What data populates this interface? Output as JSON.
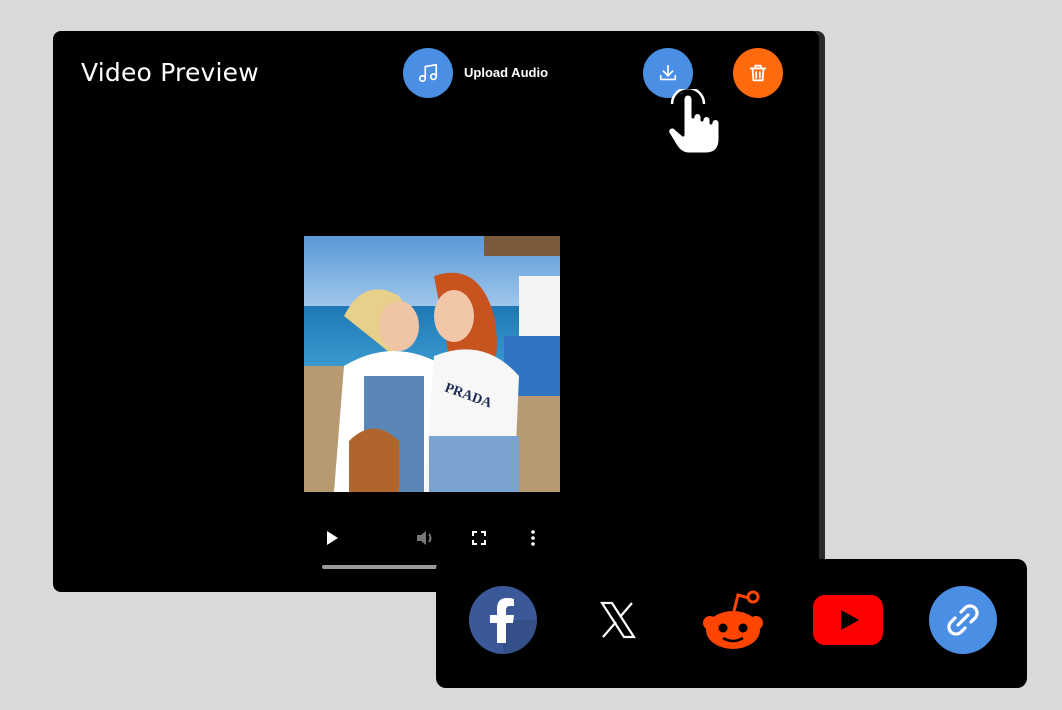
{
  "preview": {
    "title": "Video Preview",
    "upload_label": "Upload Audio"
  },
  "buttons": {
    "upload_icon": "music-note-icon",
    "download_icon": "download-icon",
    "delete_icon": "trash-icon"
  },
  "video_controls": [
    "play-icon",
    "volume-icon",
    "fullscreen-icon",
    "more-options-icon"
  ],
  "playback": {
    "progress": 1.0
  },
  "share": {
    "items": [
      "facebook",
      "x",
      "reddit",
      "youtube",
      "copy-link"
    ]
  },
  "colors": {
    "accent_blue": "#4a8fe3",
    "delete_orange": "#ff6a0d",
    "facebook": "#3b5998",
    "reddit": "#ff4500",
    "youtube": "#ff0000",
    "background": "#d9d9d9",
    "panel": "#000000"
  }
}
